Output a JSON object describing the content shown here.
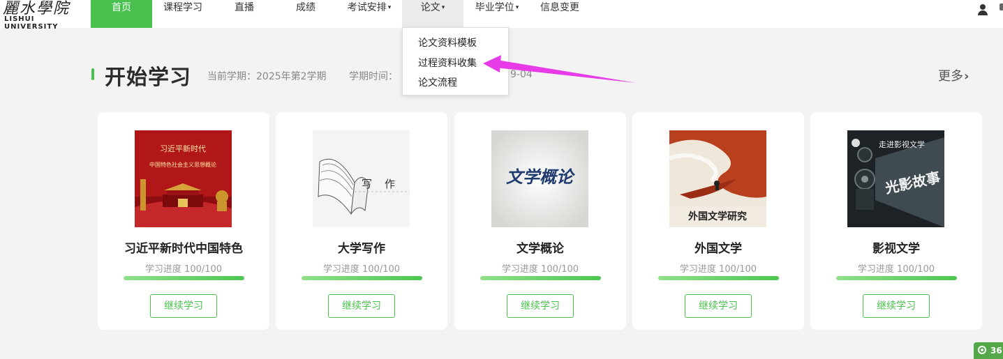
{
  "logo": {
    "name_cn": "麗水學院",
    "name_en": "LISHUI UNIVERSITY"
  },
  "nav": {
    "items": [
      {
        "label": "首页",
        "state": "active"
      },
      {
        "label": "课程学习"
      },
      {
        "label": "直播"
      },
      {
        "label": "成绩"
      },
      {
        "label": "考试安排",
        "caret": "▾"
      },
      {
        "label": "论文",
        "caret": "▾",
        "state": "open"
      },
      {
        "label": "毕业学位",
        "caret": "▾"
      },
      {
        "label": "信息变更"
      }
    ],
    "user_icon": "user-icon"
  },
  "dropdown": {
    "items": [
      {
        "label": "论文资料模板"
      },
      {
        "label": "过程资料收集"
      },
      {
        "label": "论文流程"
      }
    ]
  },
  "section": {
    "title": "开始学习",
    "semester_label": "当前学期：",
    "semester_value": "2025年第2学期",
    "time_label": "学期时间：",
    "time_tail": "9-04",
    "more_label": "更多",
    "more_chevron": "›"
  },
  "courses": [
    {
      "title": "习近平新时代中国特色",
      "progress_text": "学习进度 100/100",
      "progress": 100,
      "button": "继续学习",
      "cover_text": [
        "习近平新时代",
        "中国特色社会主义思想概论"
      ],
      "cover_icon": "tiananmen-cover-icon"
    },
    {
      "title": "大学写作",
      "progress_text": "学习进度 100/100",
      "progress": 100,
      "button": "继续学习",
      "cover_text": [
        "写",
        "作"
      ],
      "cover_icon": "open-book-cover-icon"
    },
    {
      "title": "文学概论",
      "progress_text": "学习进度 100/100",
      "progress": 100,
      "button": "继续学习",
      "cover_text": [
        "文学概论"
      ],
      "cover_icon": "calligraphy-cover-icon"
    },
    {
      "title": "外国文学",
      "progress_text": "学习进度 100/100",
      "progress": 100,
      "button": "继续学习",
      "cover_text": [
        "外国文学研究"
      ],
      "cover_icon": "boat-river-cover-icon"
    },
    {
      "title": "影视文学",
      "progress_text": "学习进度 100/100",
      "progress": 100,
      "button": "继续学习",
      "cover_text": [
        "走进影视文学",
        "光影故事"
      ],
      "cover_icon": "film-projector-cover-icon"
    }
  ],
  "corner_widget": {
    "text": "36"
  },
  "colors": {
    "accent": "#4ac04e",
    "annotation_arrow": "#e83be8",
    "page_bg": "#f3f3f3"
  }
}
